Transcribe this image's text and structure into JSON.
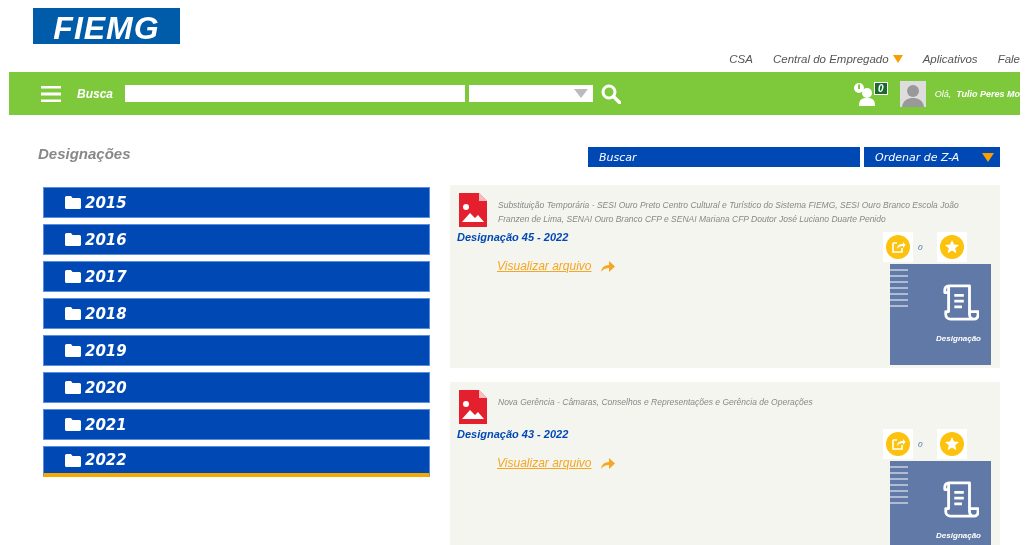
{
  "logo": {
    "text": "FIEMG"
  },
  "top_links": [
    {
      "label": "CSA",
      "dropdown": false
    },
    {
      "label": "Central do Empregado",
      "dropdown": true
    },
    {
      "label": "Aplicativos",
      "dropdown": false
    },
    {
      "label": "Fale",
      "dropdown": false
    }
  ],
  "navbar": {
    "search_label": "Busca",
    "notification_count": "0",
    "greeting": "Olá,",
    "user_name": "Tulio Peres Mo"
  },
  "page_title": "Designações",
  "filter": {
    "search_button": "Buscar",
    "sort": "Ordenar de Z-A"
  },
  "years": [
    {
      "label": "2015",
      "selected": false
    },
    {
      "label": "2016",
      "selected": false
    },
    {
      "label": "2017",
      "selected": false
    },
    {
      "label": "2018",
      "selected": false
    },
    {
      "label": "2019",
      "selected": false
    },
    {
      "label": "2020",
      "selected": false
    },
    {
      "label": "2021",
      "selected": false
    },
    {
      "label": "2022",
      "selected": true
    }
  ],
  "documents": [
    {
      "description": "Substituição Temporária - SESI Ouro Preto Centro Cultural e Turístico do Sistema FIEMG, SESI Ouro Branco Escola João Franzen de Lima, SENAI Ouro Branco CFP e SENAI Mariana CFP Doutor José Luciano Duarte Penido",
      "title": "Designação 45 - 2022",
      "link": "Visualizar arquivo",
      "share_count": "0",
      "thumb_label": "Designação"
    },
    {
      "description": "Nova Gerência - Câmaras, Conselhos e Representações e Gerência de Operações",
      "title": "Designação 43 - 2022",
      "link": "Visualizar arquivo",
      "share_count": "0",
      "thumb_label": "Designação"
    }
  ]
}
